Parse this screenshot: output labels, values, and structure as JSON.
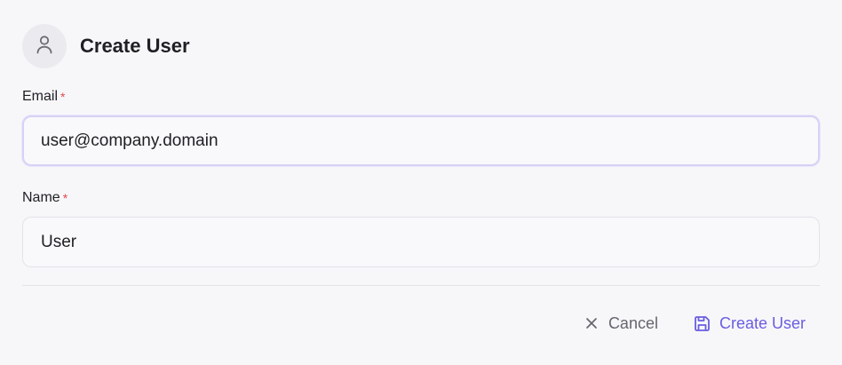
{
  "dialog": {
    "title": "Create User",
    "avatar_icon": "user-icon"
  },
  "form": {
    "email": {
      "label": "Email",
      "required_mark": "*",
      "value": "user@company.domain"
    },
    "name": {
      "label": "Name",
      "required_mark": "*",
      "value": "User"
    }
  },
  "footer": {
    "cancel_label": "Cancel",
    "cancel_icon": "close-icon",
    "create_label": "Create User",
    "create_icon": "save-icon"
  },
  "colors": {
    "accent": "#6a5de0",
    "required": "#e5484d",
    "focus_ring": "#d6d2f5"
  }
}
